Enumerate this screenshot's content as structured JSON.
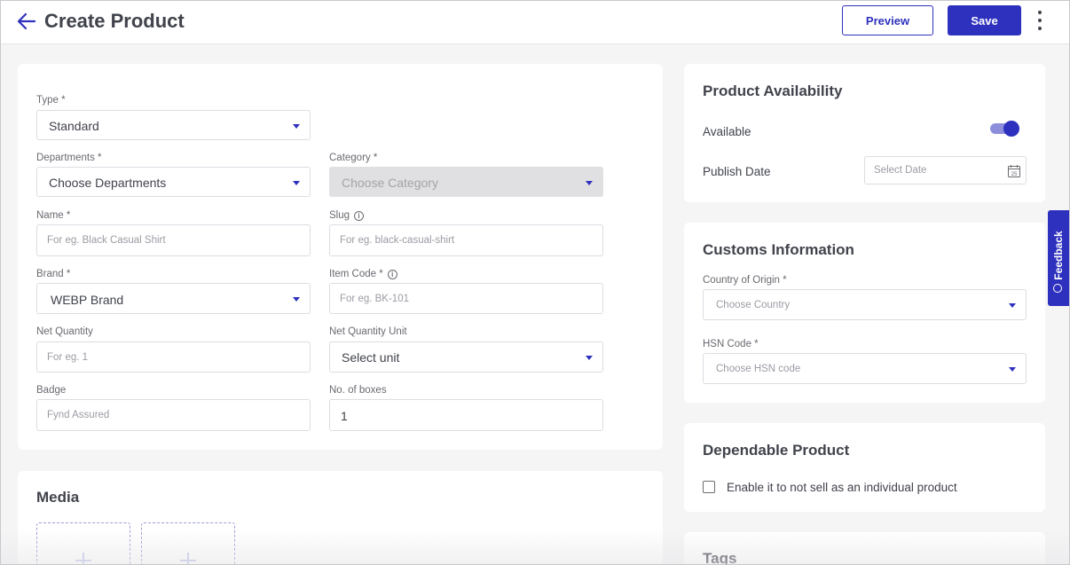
{
  "header": {
    "title": "Create Product",
    "preview_label": "Preview",
    "save_label": "Save"
  },
  "form": {
    "type": {
      "label": "Type *",
      "value": "Standard"
    },
    "departments": {
      "label": "Departments *",
      "value": "Choose Departments"
    },
    "category": {
      "label": "Category *",
      "value": "Choose Category"
    },
    "name": {
      "label": "Name *",
      "placeholder": "For eg. Black Casual Shirt"
    },
    "slug": {
      "label": "Slug",
      "placeholder": "For eg. black-casual-shirt"
    },
    "brand": {
      "label": "Brand *",
      "value": "WEBP Brand"
    },
    "item_code": {
      "label": "Item Code *",
      "placeholder": "For eg. BK-101"
    },
    "net_quantity": {
      "label": "Net Quantity",
      "placeholder": "For eg. 1"
    },
    "net_quantity_unit": {
      "label": "Net Quantity Unit",
      "value": "Select unit"
    },
    "badge": {
      "label": "Badge",
      "placeholder": "Fynd Assured"
    },
    "boxes": {
      "label": "No. of boxes",
      "value": "1"
    },
    "info_glyph": "i"
  },
  "media": {
    "title": "Media"
  },
  "availability": {
    "title": "Product Availability",
    "available_label": "Available",
    "available": true,
    "publish_date_label": "Publish Date",
    "publish_date_placeholder": "Select Date",
    "calendar_day": "25"
  },
  "customs": {
    "title": "Customs Information",
    "country_label": "Country of Origin *",
    "country_placeholder": "Choose Country",
    "hsn_label": "HSN Code *",
    "hsn_placeholder": "Choose HSN code"
  },
  "dependable": {
    "title": "Dependable Product",
    "checkbox_label": "Enable it to not sell as an individual product",
    "checked": false
  },
  "tags": {
    "title": "Tags"
  },
  "feedback": {
    "label": "Feedback"
  },
  "colors": {
    "primary": "#2e31be",
    "background": "#f5f5f6",
    "text": "#41434c"
  }
}
